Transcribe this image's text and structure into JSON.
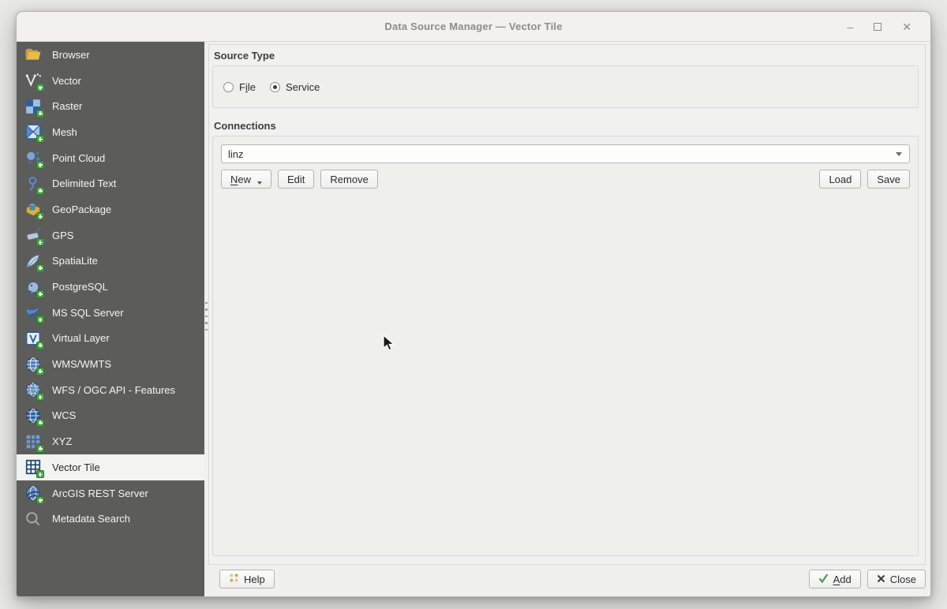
{
  "window": {
    "title": "Data Source Manager — Vector Tile",
    "controls": {
      "minimize_glyph": "–",
      "close_glyph": "✕"
    }
  },
  "sidebar": {
    "items": [
      {
        "label": "Browser",
        "icon": "folder-icon",
        "has_add_badge": false,
        "selected": false
      },
      {
        "label": "Vector",
        "icon": "vector-icon",
        "has_add_badge": true,
        "selected": false
      },
      {
        "label": "Raster",
        "icon": "raster-icon",
        "has_add_badge": true,
        "selected": false
      },
      {
        "label": "Mesh",
        "icon": "mesh-icon",
        "has_add_badge": true,
        "selected": false
      },
      {
        "label": "Point Cloud",
        "icon": "point-cloud-icon",
        "has_add_badge": true,
        "selected": false
      },
      {
        "label": "Delimited Text",
        "icon": "delimited-text-icon",
        "has_add_badge": true,
        "selected": false
      },
      {
        "label": "GeoPackage",
        "icon": "geopackage-icon",
        "has_add_badge": true,
        "selected": false
      },
      {
        "label": "GPS",
        "icon": "gps-icon",
        "has_add_badge": true,
        "selected": false
      },
      {
        "label": "SpatiaLite",
        "icon": "spatialite-icon",
        "has_add_badge": true,
        "selected": false
      },
      {
        "label": "PostgreSQL",
        "icon": "postgresql-icon",
        "has_add_badge": true,
        "selected": false
      },
      {
        "label": "MS SQL Server",
        "icon": "mssql-icon",
        "has_add_badge": true,
        "selected": false
      },
      {
        "label": "Virtual Layer",
        "icon": "virtual-layer-icon",
        "has_add_badge": true,
        "selected": false
      },
      {
        "label": "WMS/WMTS",
        "icon": "wms-icon",
        "has_add_badge": true,
        "selected": false
      },
      {
        "label": "WFS / OGC API - Features",
        "icon": "wfs-icon",
        "has_add_badge": true,
        "selected": false
      },
      {
        "label": "WCS",
        "icon": "wcs-icon",
        "has_add_badge": true,
        "selected": false
      },
      {
        "label": "XYZ",
        "icon": "xyz-icon",
        "has_add_badge": true,
        "selected": false
      },
      {
        "label": "Vector Tile",
        "icon": "vector-tile-icon",
        "has_add_badge": true,
        "selected": true
      },
      {
        "label": "ArcGIS REST Server",
        "icon": "arcgis-icon",
        "has_add_badge": true,
        "selected": false
      },
      {
        "label": "Metadata Search",
        "icon": "search-icon",
        "has_add_badge": false,
        "selected": false
      }
    ]
  },
  "main": {
    "source_type": {
      "heading": "Source Type",
      "options": [
        {
          "label": "File",
          "mnemonic_index": 1,
          "selected": false
        },
        {
          "label": "Service",
          "mnemonic_index": -1,
          "selected": true
        }
      ]
    },
    "connections": {
      "heading": "Connections",
      "selected_connection": "linz",
      "new_button": {
        "label": "New",
        "mnemonic_index": 0
      },
      "edit_label": "Edit",
      "remove_label": "Remove",
      "load_label": "Load",
      "save_label": "Save"
    }
  },
  "footer": {
    "help_label": "Help",
    "add_button": {
      "label": "Add",
      "mnemonic_index": 0
    },
    "close_label": "Close"
  },
  "colors": {
    "sidebar_bg": "#5c5c5b",
    "selected_item_bg": "#f3f3f1",
    "titlebar_bg": "#f2f1ef",
    "content_bg": "#f1f1ef",
    "add_badge_green": "#44a83e",
    "check_green": "#4e9a4e"
  }
}
